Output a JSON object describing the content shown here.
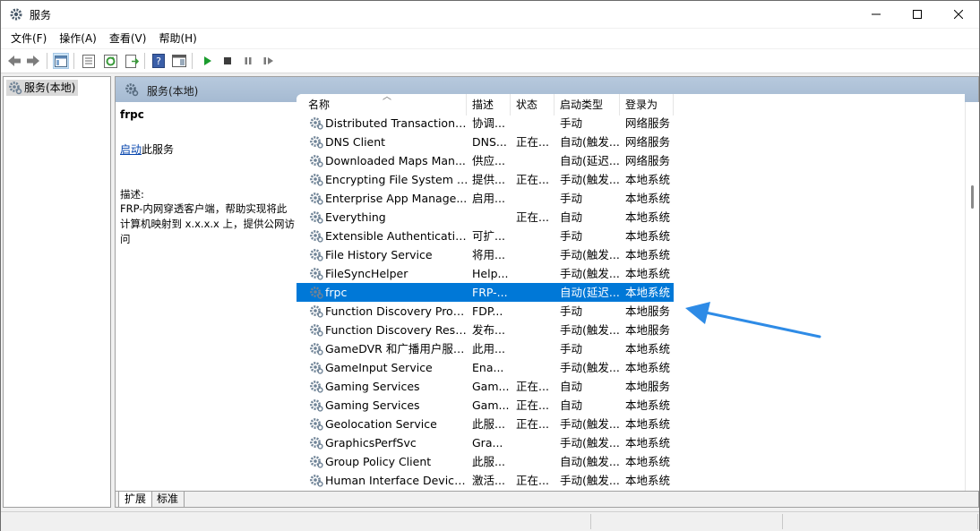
{
  "window": {
    "title": "服务"
  },
  "menu": [
    "文件(F)",
    "操作(A)",
    "查看(V)",
    "帮助(H)"
  ],
  "toolbar_icons": [
    "back-icon",
    "forward-icon",
    "show-hide-console-tree-icon",
    "properties-icon",
    "refresh-icon",
    "export-list-icon",
    "help-icon",
    "show-action-pane-icon",
    "start-service-icon",
    "stop-service-icon",
    "pause-service-icon",
    "resume-service-icon"
  ],
  "tree": {
    "item": "服务(本地)"
  },
  "pane": {
    "header": "服务(本地)",
    "selected_name": "frpc",
    "start_link": "启动",
    "start_suffix": "此服务",
    "desc_label": "描述:",
    "desc_text": "FRP-内网穿透客户端，帮助实现将此计算机映射到 x.x.x.x 上，提供公网访问"
  },
  "columns": [
    "名称",
    "描述",
    "状态",
    "启动类型",
    "登录为"
  ],
  "services": [
    {
      "name": "Distributed Transaction C...",
      "desc": "协调...",
      "status": "",
      "start": "手动",
      "logon": "网络服务"
    },
    {
      "name": "DNS Client",
      "desc": "DNS...",
      "status": "正在...",
      "start": "自动(触发...",
      "logon": "网络服务"
    },
    {
      "name": "Downloaded Maps Man...",
      "desc": "供应...",
      "status": "",
      "start": "自动(延迟...",
      "logon": "网络服务"
    },
    {
      "name": "Encrypting File System (E...",
      "desc": "提供...",
      "status": "正在...",
      "start": "手动(触发...",
      "logon": "本地系统"
    },
    {
      "name": "Enterprise App Manage...",
      "desc": "启用...",
      "status": "",
      "start": "手动",
      "logon": "本地系统"
    },
    {
      "name": "Everything",
      "desc": "",
      "status": "正在...",
      "start": "自动",
      "logon": "本地系统"
    },
    {
      "name": "Extensible Authentication...",
      "desc": "可扩...",
      "status": "",
      "start": "手动",
      "logon": "本地系统"
    },
    {
      "name": "File History Service",
      "desc": "将用...",
      "status": "",
      "start": "手动(触发...",
      "logon": "本地系统"
    },
    {
      "name": "FileSyncHelper",
      "desc": "Help...",
      "status": "",
      "start": "手动(触发...",
      "logon": "本地系统"
    },
    {
      "name": "frpc",
      "desc": "FRP-...",
      "status": "",
      "start": "自动(延迟...",
      "logon": "本地系统",
      "selected": true
    },
    {
      "name": "Function Discovery Provi...",
      "desc": "FDP...",
      "status": "",
      "start": "手动",
      "logon": "本地服务"
    },
    {
      "name": "Function Discovery Reso...",
      "desc": "发布...",
      "status": "",
      "start": "手动(触发...",
      "logon": "本地服务"
    },
    {
      "name": "GameDVR 和广播用户服务...",
      "desc": "此用...",
      "status": "",
      "start": "手动",
      "logon": "本地系统"
    },
    {
      "name": "GameInput Service",
      "desc": "Ena...",
      "status": "",
      "start": "手动(触发...",
      "logon": "本地系统"
    },
    {
      "name": "Gaming Services",
      "desc": "Gam...",
      "status": "正在...",
      "start": "自动",
      "logon": "本地服务"
    },
    {
      "name": "Gaming Services",
      "desc": "Gam...",
      "status": "正在...",
      "start": "自动",
      "logon": "本地系统"
    },
    {
      "name": "Geolocation Service",
      "desc": "此服...",
      "status": "正在...",
      "start": "手动(触发...",
      "logon": "本地系统"
    },
    {
      "name": "GraphicsPerfSvc",
      "desc": "Gra...",
      "status": "",
      "start": "手动(触发...",
      "logon": "本地系统"
    },
    {
      "name": "Group Policy Client",
      "desc": "此服...",
      "status": "",
      "start": "自动(触发...",
      "logon": "本地系统"
    },
    {
      "name": "Human Interface Device...",
      "desc": "激活...",
      "status": "正在...",
      "start": "手动(触发...",
      "logon": "本地系统"
    }
  ],
  "tabs": [
    "扩展",
    "标准"
  ],
  "colors": {
    "selection": "#0078d7",
    "header_band": "#b7c9dd",
    "arrow": "#2e8be6"
  }
}
